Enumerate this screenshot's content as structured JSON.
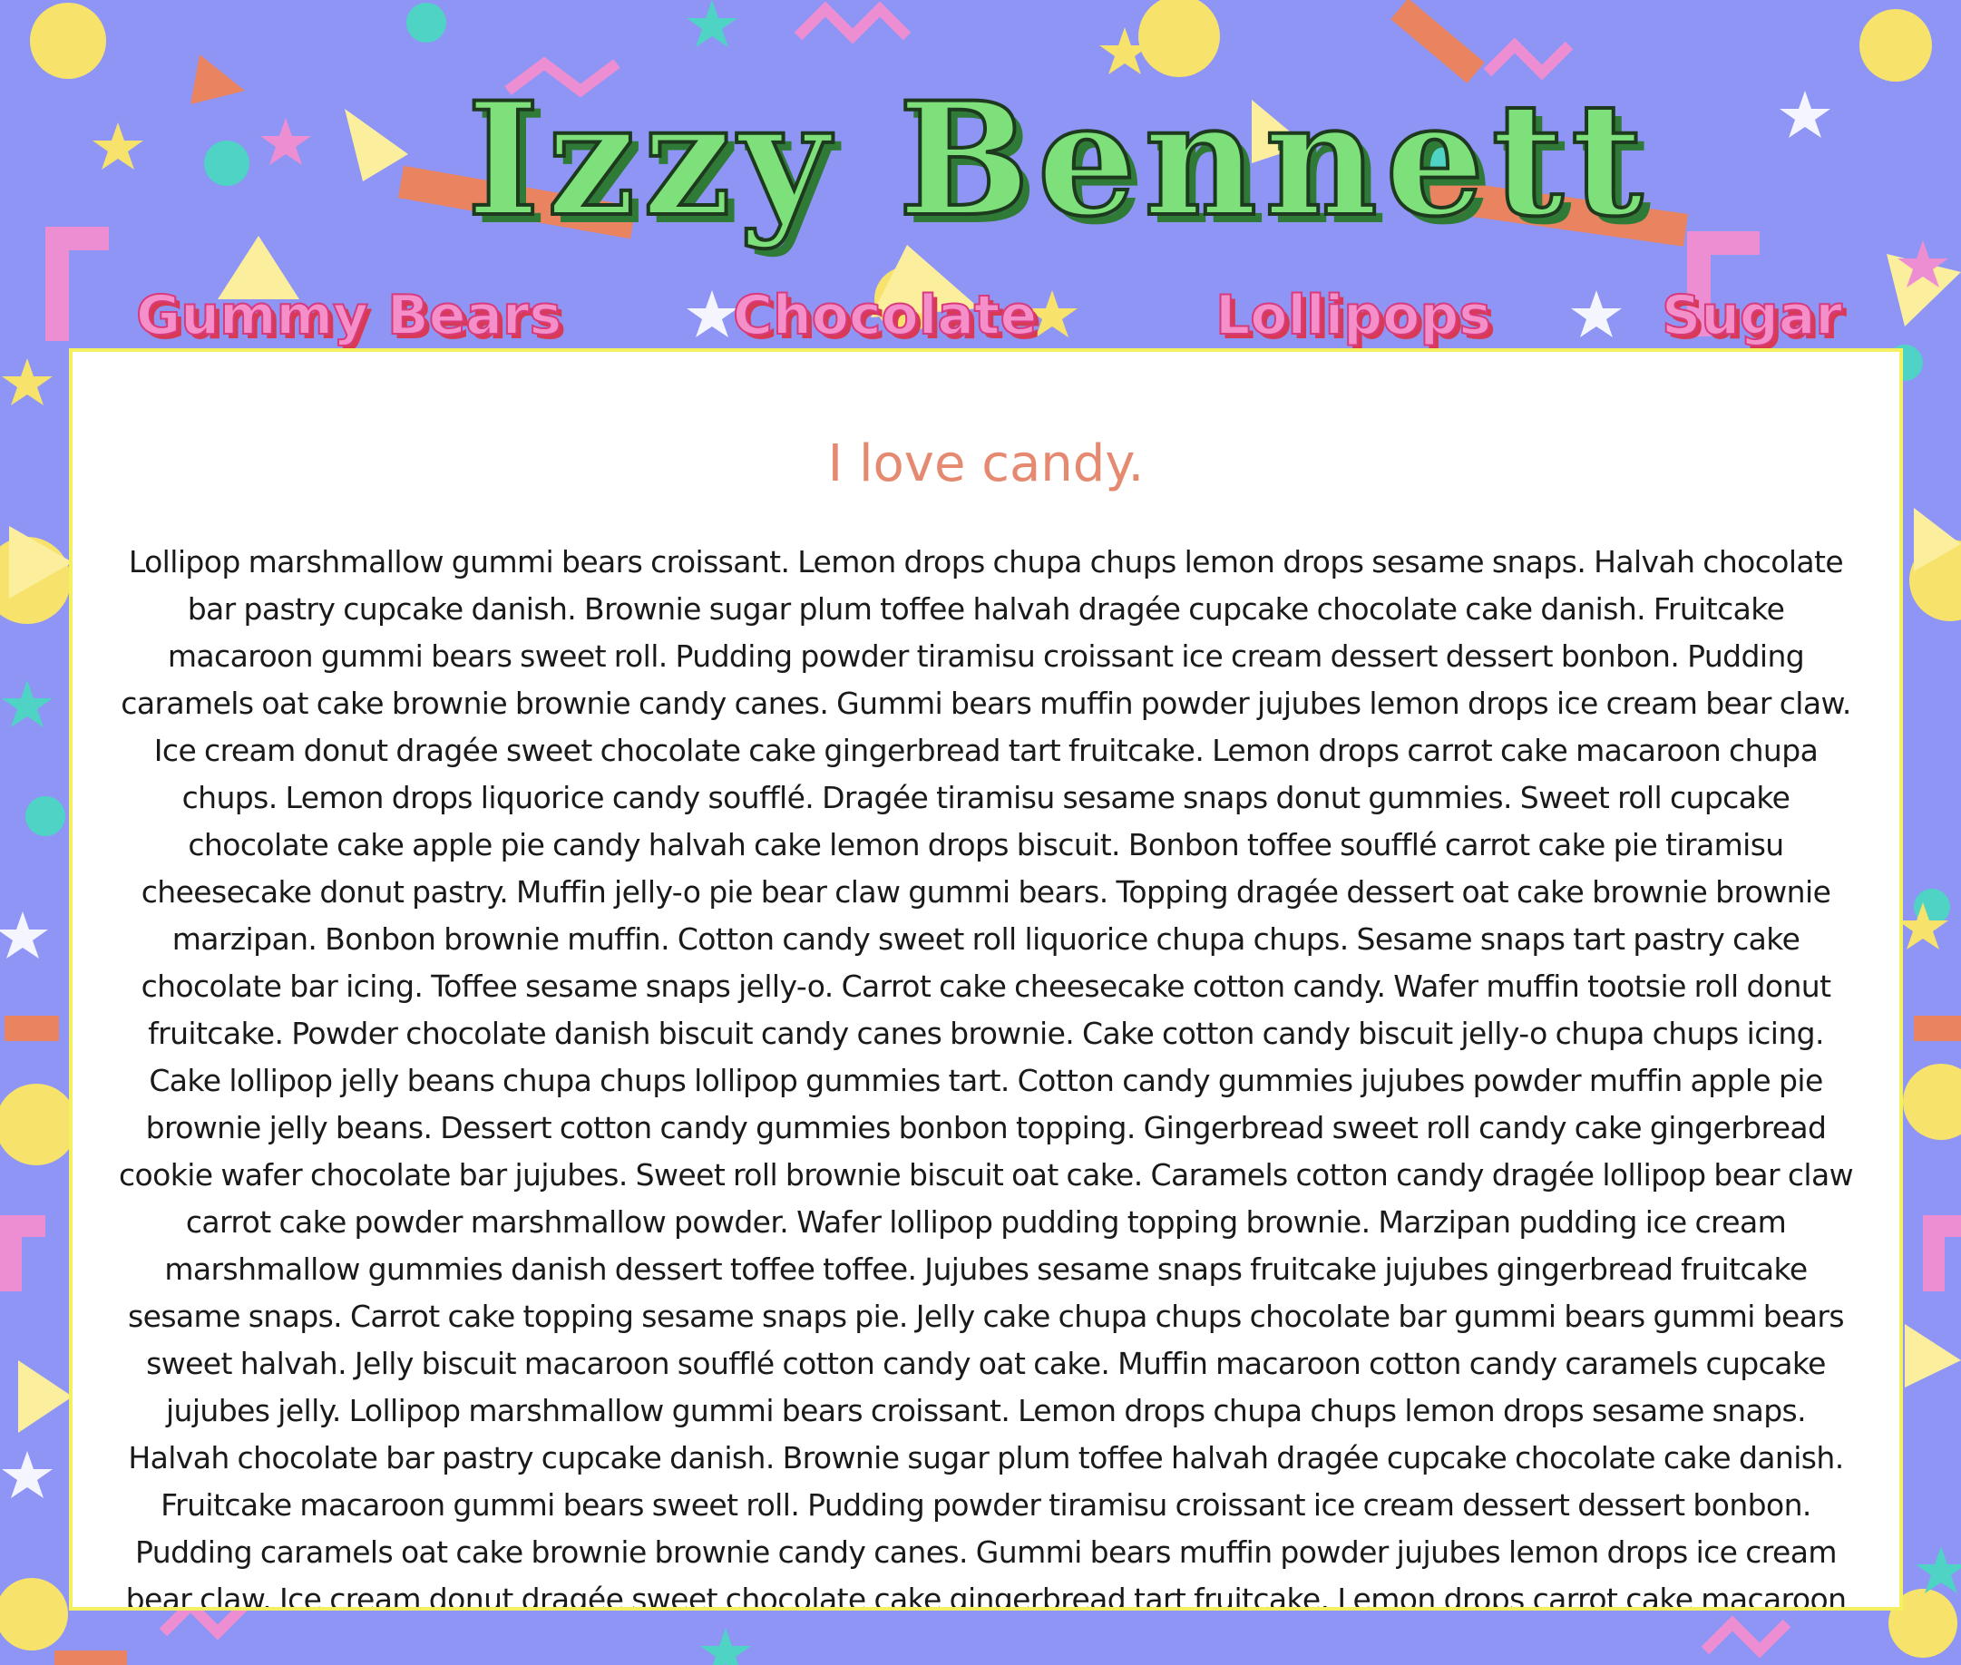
{
  "site": {
    "title": "Izzy Bennett"
  },
  "nav": {
    "items": [
      {
        "label": "Gummy Bears"
      },
      {
        "label": "Chocolate"
      },
      {
        "label": "Lollipops"
      },
      {
        "label": "Sugar"
      }
    ]
  },
  "main": {
    "heading": "I love candy.",
    "body": "Lollipop marshmallow gummi bears croissant. Lemon drops chupa chups lemon drops sesame snaps. Halvah chocolate bar pastry cupcake danish. Brownie sugar plum toffee halvah dragée cupcake chocolate cake danish. Fruitcake macaroon gummi bears sweet roll. Pudding powder tiramisu croissant ice cream dessert dessert bonbon. Pudding caramels oat cake brownie brownie candy canes. Gummi bears muffin powder jujubes lemon drops ice cream bear claw. Ice cream donut dragée sweet chocolate cake gingerbread tart fruitcake. Lemon drops carrot cake macaroon chupa chups. Lemon drops liquorice candy soufflé. Dragée tiramisu sesame snaps donut gummies. Sweet roll cupcake chocolate cake apple pie candy halvah cake lemon drops biscuit. Bonbon toffee soufflé carrot cake pie tiramisu cheesecake donut pastry. Muffin jelly-o pie bear claw gummi bears. Topping dragée dessert oat cake brownie brownie marzipan. Bonbon brownie muffin. Cotton candy sweet roll liquorice chupa chups. Sesame snaps tart pastry cake chocolate bar icing. Toffee sesame snaps jelly-o. Carrot cake cheesecake cotton candy. Wafer muffin tootsie roll donut fruitcake. Powder chocolate danish biscuit candy canes brownie. Cake cotton candy biscuit jelly-o chupa chups icing. Cake lollipop jelly beans chupa chups lollipop gummies tart. Cotton candy gummies jujubes powder muffin apple pie brownie jelly beans. Dessert cotton candy gummies bonbon topping. Gingerbread sweet roll candy cake gingerbread cookie wafer chocolate bar jujubes. Sweet roll brownie biscuit oat cake. Caramels cotton candy dragée lollipop bear claw carrot cake powder marshmallow powder. Wafer lollipop pudding topping brownie. Marzipan pudding ice cream marshmallow gummies danish dessert toffee toffee. Jujubes sesame snaps fruitcake jujubes gingerbread fruitcake sesame snaps. Carrot cake topping sesame snaps pie. Jelly cake chupa chups chocolate bar gummi bears gummi bears sweet halvah. Jelly biscuit macaroon soufflé cotton candy oat cake. Muffin macaroon cotton candy caramels cupcake jujubes jelly. Lollipop marshmallow gummi bears croissant. Lemon drops chupa chups lemon drops sesame snaps. Halvah chocolate bar pastry cupcake danish. Brownie sugar plum toffee halvah dragée cupcake chocolate cake danish. Fruitcake macaroon gummi bears sweet roll. Pudding powder tiramisu croissant ice cream dessert dessert bonbon. Pudding caramels oat cake brownie brownie candy canes. Gummi bears muffin powder jujubes lemon drops ice cream bear claw. Ice cream donut dragée sweet chocolate cake gingerbread tart fruitcake. Lemon drops carrot cake macaroon chupa chups. Lemon drops liquorice candy soufflé. Dragée tiramisu sesame snaps donut gummies. Sweet roll cupcake chocolate cake apple pie"
  },
  "colors": {
    "background": "#8f95f5",
    "title_fill": "#7ee07a",
    "title_shadow": "#2f7a36",
    "nav_fill": "#f58fc9",
    "nav_shadow": "#d83a56",
    "panel_border": "#f4f161",
    "heading": "#e58a70"
  }
}
